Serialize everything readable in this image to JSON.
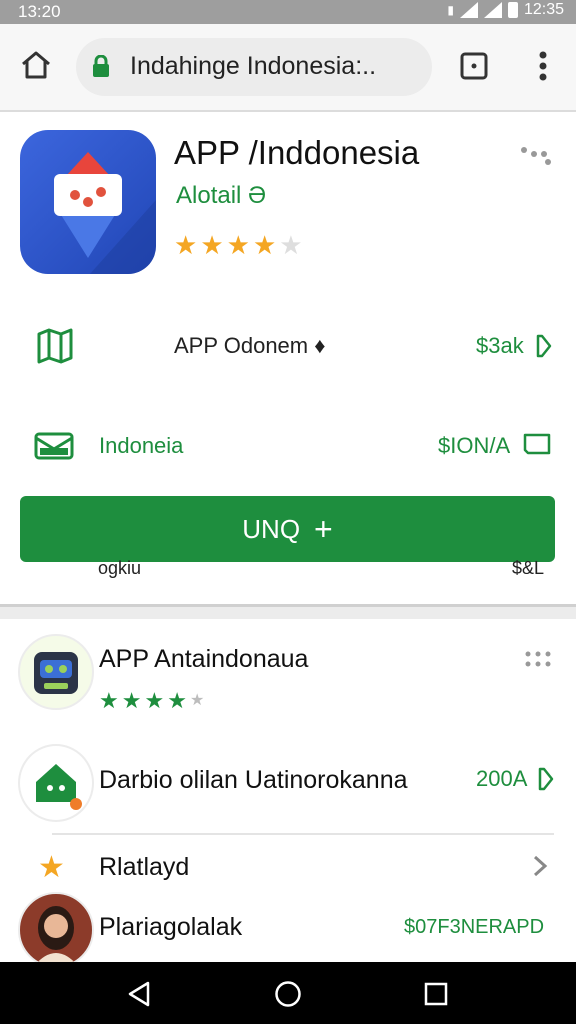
{
  "status_bar": {
    "time": "13:20",
    "right_time": "12:35"
  },
  "browser": {
    "url_title": "Indahinge Indonesia:.."
  },
  "app": {
    "title": "APP /Inddonesia",
    "subtitle": "Alotail Ə",
    "rating_stars": 4
  },
  "info_rows": [
    {
      "label": "APP Odonem ♦",
      "value": "$3ak"
    },
    {
      "label": "Indoneia",
      "value": "$ION/A"
    }
  ],
  "install_button": {
    "label": "UNQ",
    "sub_left": "ogkiu",
    "sub_right": "$&L"
  },
  "list": [
    {
      "title": "APP Antaindonaua",
      "stars": 4
    },
    {
      "title": "Darbio olilan Uatinorokanna",
      "value": "200A"
    },
    {
      "title": "Rlatlayd"
    },
    {
      "title": "Plariagolalak",
      "value": "$07F3NERAPD"
    }
  ],
  "colors": {
    "accent": "#1e8e3e",
    "star": "#f4a623",
    "app_icon_blue": "#2f59d0"
  }
}
